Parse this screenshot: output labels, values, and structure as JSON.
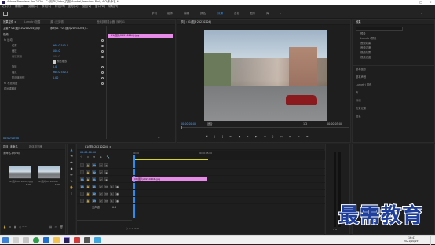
{
  "window": {
    "title": "Adobe Premiere Pro 2020 - C:\\用户\\Yinbo\\文档\\Adobe\\Premiere Pro\\14.0\\未命名 *"
  },
  "menu": [
    "文件(F)",
    "编辑(E)",
    "剪辑(C)",
    "序列(S)",
    "标记(M)",
    "图形(G)",
    "视图(V)",
    "窗口(W)",
    "帮助(H)"
  ],
  "workspaces": [
    "学习",
    "组件",
    "编辑",
    "颜色",
    "效果",
    "音频",
    "图形",
    "库"
  ],
  "active_workspace": "效果",
  "effect_controls": {
    "tabs": [
      "效果控件 ≡",
      "Lumetri 范围",
      "源: (无剪辑)",
      "音频剪辑混合器: 序列01"
    ],
    "clip": "主要 * 01(图片20210204).jpg",
    "sequence": "序列01 * 01(图片20210204)...",
    "sections": [
      {
        "label": "视频",
        "kind": "header"
      },
      {
        "label": "fx 运动",
        "kind": "group"
      },
      {
        "label": "位置",
        "value": "960.0   540.0",
        "kind": "prop"
      },
      {
        "label": "缩放",
        "value": "100.0",
        "kind": "prop"
      },
      {
        "label": "缩放宽度",
        "value": "100.0",
        "kind": "prop-dim"
      },
      {
        "label": "等比缩放",
        "value": "",
        "kind": "check"
      },
      {
        "label": "旋转",
        "value": "0.0",
        "kind": "prop"
      },
      {
        "label": "锚点",
        "value": "960.0   540.0",
        "kind": "prop"
      },
      {
        "label": "防闪烁滤镜",
        "value": "0.00",
        "kind": "prop"
      },
      {
        "label": "fx 不透明度",
        "value": "",
        "kind": "group"
      },
      {
        "label": "时间重映射",
        "value": "",
        "kind": "group"
      }
    ],
    "clip_bar_label": "01(图片20210204).jpg",
    "timecode": "00:00:00:00"
  },
  "program": {
    "tab": "节目: 01(图片20210204)",
    "timecode_left": "00:00:00:00",
    "fit": "适合",
    "ratio": "1/2",
    "timecode_right": "00:00:05:00"
  },
  "right_panel": {
    "header": "效果",
    "items": [
      "预设",
      "Lumetri 预设",
      "音频效果",
      "音频过渡",
      "视频效果",
      "视频过渡"
    ],
    "sections": [
      "基本图形",
      "基本声音",
      "Lumetri 颜色",
      "库",
      "标记",
      "历史记录",
      "信息"
    ]
  },
  "project": {
    "tabs": [
      "项目: 未命名",
      "媒体浏览器"
    ],
    "name": "未命名.prproj",
    "items": [
      {
        "name": "01(图片20210204).jpg",
        "dur": "5:00"
      },
      {
        "name": "01(图片20210204)",
        "dur": "5:00"
      }
    ]
  },
  "timeline": {
    "tab": "01(图片20210204) ≡",
    "timecode": "00:00:00:00",
    "ruler": [
      "00:00",
      "00:00:05:00"
    ],
    "tracks": [
      "V3",
      "V2",
      "V1",
      "A1",
      "A2",
      "A3"
    ],
    "master": "主声道",
    "master_value": "0.0",
    "clip_label": "01(图片20210204).jpg"
  },
  "taskbar": {
    "time": "16:47",
    "date": "2021/10/19"
  },
  "watermark": "最需教育",
  "colors": {
    "accent": "#2d8ceb",
    "clip": "#e78be8",
    "bg": "#1e1e1e"
  }
}
